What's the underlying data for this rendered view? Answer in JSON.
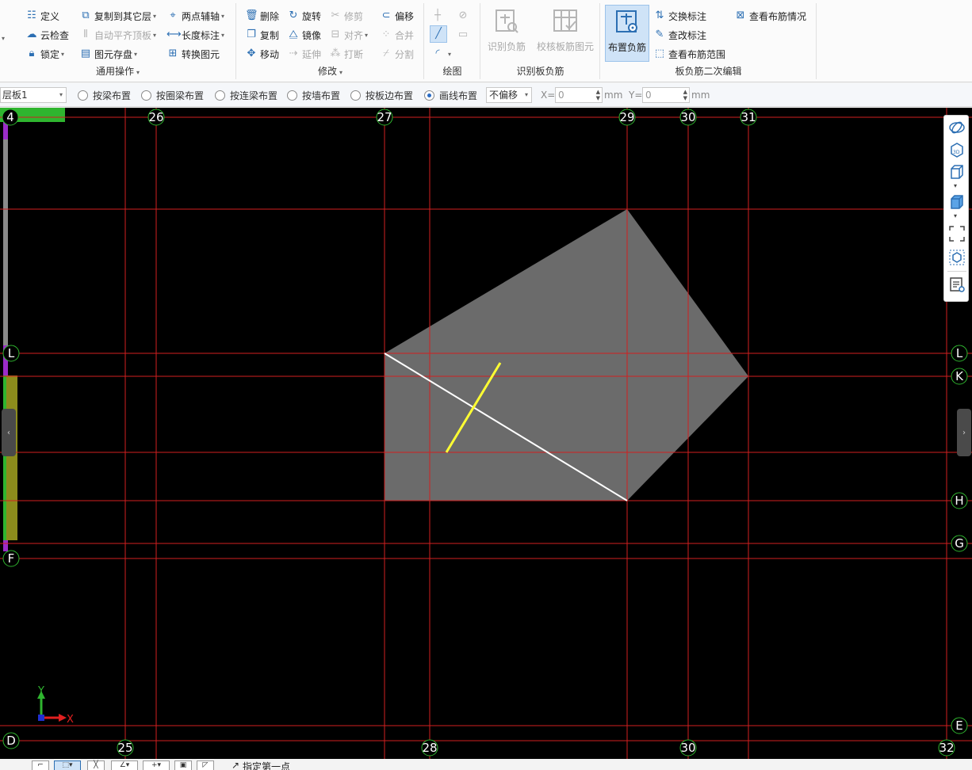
{
  "ribbon": {
    "general": {
      "title": "通用操作",
      "define": "定义",
      "cloud_check": "云检查",
      "lock": "锁定",
      "copy_to_floor": "复制到其它层",
      "auto_align_top": "自动平齐顶板",
      "element_storage": "图元存盘",
      "two_point_axis": "两点辅轴",
      "length_dim": "长度标注",
      "convert_element": "转换图元"
    },
    "modify": {
      "title": "修改",
      "delete": "删除",
      "copy": "复制",
      "move": "移动",
      "rotate": "旋转",
      "mirror": "镜像",
      "extend": "延伸",
      "trim": "修剪",
      "align": "对齐",
      "break": "打断",
      "offset": "偏移",
      "merge": "合并",
      "split": "分割"
    },
    "draw": {
      "title": "绘图"
    },
    "identify": {
      "title": "识别板负筋",
      "identify_neg": "识别负筋",
      "check_slab": "校核板筋图元"
    },
    "secondary": {
      "title": "板负筋二次编辑",
      "place_neg": "布置负筋",
      "swap_label": "交换标注",
      "edit_label": "查改标注",
      "view_range": "查看布筋范围",
      "view_layout": "查看布筋情况"
    }
  },
  "toolbar": {
    "layer": "层板1",
    "radios": [
      {
        "label": "按梁布置",
        "checked": false
      },
      {
        "label": "按圈梁布置",
        "checked": false
      },
      {
        "label": "按连梁布置",
        "checked": false
      },
      {
        "label": "按墙布置",
        "checked": false
      },
      {
        "label": "按板边布置",
        "checked": false
      },
      {
        "label": "画线布置",
        "checked": true
      }
    ],
    "offset_mode": "不偏移",
    "x_label": "X=",
    "x_value": "0",
    "y_label": "Y=",
    "y_value": "0",
    "unit": "mm"
  },
  "canvas": {
    "top_axes": [
      "4",
      "26",
      "27",
      "29",
      "30",
      "31"
    ],
    "bottom_axes": [
      "25",
      "28",
      "30",
      "32"
    ],
    "left_axes": [
      "L",
      "F",
      "D"
    ],
    "right_axes": [
      "L",
      "K",
      "H",
      "G",
      "E"
    ],
    "coord_x": "X",
    "coord_y": "Y",
    "colors": {
      "grid": "#d21f1f",
      "slab": "#6b6b6b",
      "rebar": "#ffff33",
      "support_line": "#ffffff",
      "axis_bubble": "#2fb52f"
    }
  },
  "statusbar": {
    "hint": "指定第一点"
  }
}
